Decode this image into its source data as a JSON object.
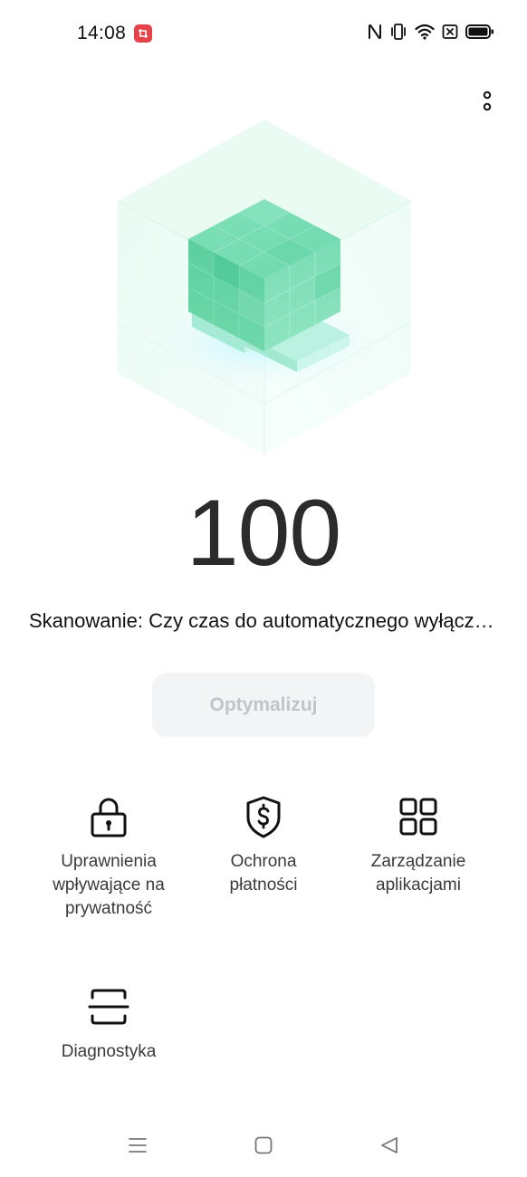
{
  "status_bar": {
    "time": "14:08",
    "icons": [
      "screenshot-notification-icon",
      "nfc-icon",
      "vibrate-icon",
      "wifi-icon",
      "sim-blocked-icon",
      "battery-icon"
    ]
  },
  "header": {
    "menu_icon": "more-vertical-icon"
  },
  "hero": {
    "illustration": "green-cube-icon"
  },
  "score": {
    "value": "100"
  },
  "scan": {
    "text": "Skanowanie: Czy czas do automatycznego wyłącz…"
  },
  "optimize": {
    "label": "Optymalizuj"
  },
  "tools": [
    {
      "label": "Uprawnienia\nwpływające na\nprywatność",
      "icon": "lock-icon"
    },
    {
      "label": "Ochrona\npłatności",
      "icon": "shield-dollar-icon"
    },
    {
      "label": "Zarządzanie\naplikacjami",
      "icon": "app-grid-icon"
    },
    {
      "label": "Diagnostyka",
      "icon": "scan-frame-icon"
    }
  ],
  "nav": {
    "icons": [
      "menu-icon",
      "home-icon",
      "back-icon"
    ]
  },
  "colors": {
    "optimize_bg": "#f3f4f6",
    "optimize_text": "#c1c4cb",
    "cube_green": "#5fd3a5",
    "notification_red": "#e6424a"
  }
}
